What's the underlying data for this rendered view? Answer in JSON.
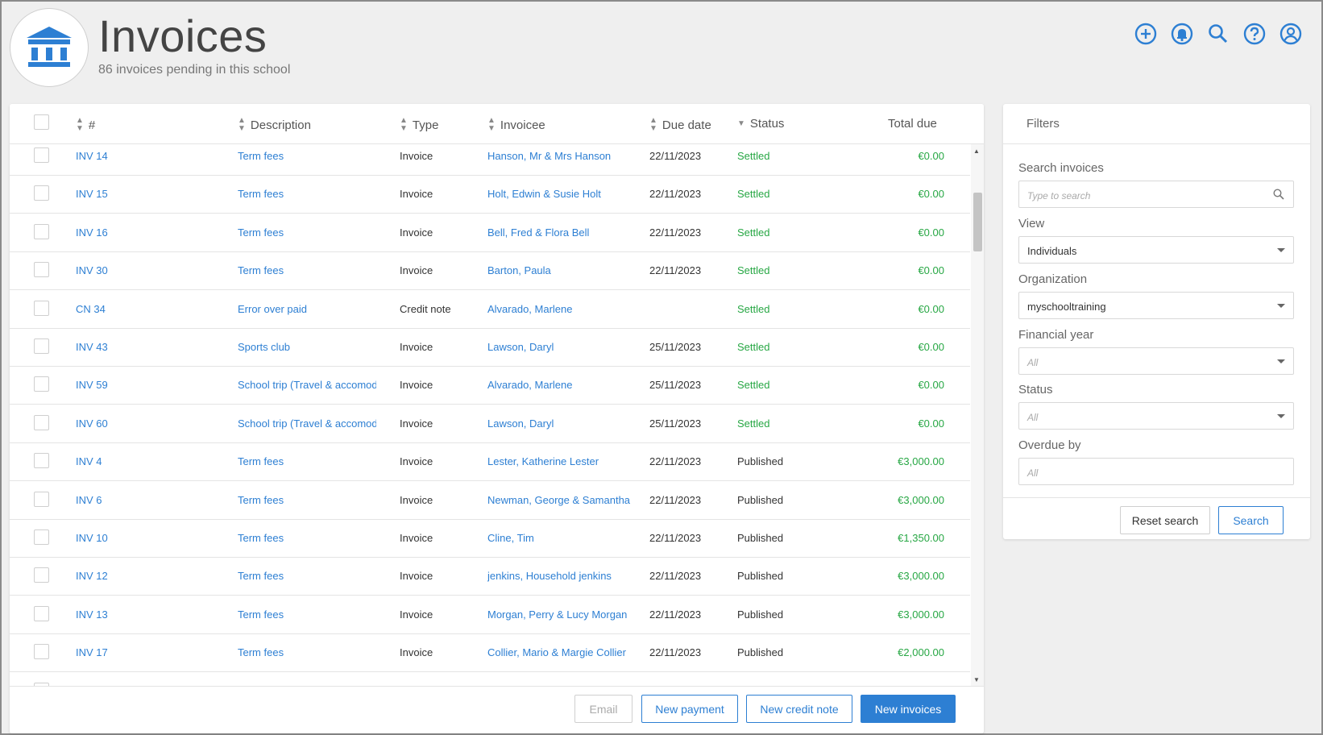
{
  "header": {
    "title": "Invoices",
    "subtitle": "86 invoices pending in this school",
    "icons": [
      "add-circle-icon",
      "bell-icon",
      "search-icon",
      "help-icon",
      "user-icon"
    ]
  },
  "colors": {
    "accent": "#2d7fd3",
    "success": "#27a744"
  },
  "table": {
    "columns": {
      "number": "#",
      "description": "Description",
      "type": "Type",
      "invoicee": "Invoicee",
      "due_date": "Due date",
      "status": "Status",
      "total_due": "Total due"
    },
    "rows": [
      {
        "number": "INV 14",
        "description": "Term fees",
        "type": "Invoice",
        "invoicee": "Hanson, Mr & Mrs Hanson",
        "due_date": "22/11/2023",
        "status": "Settled",
        "total": "€0.00"
      },
      {
        "number": "INV 15",
        "description": "Term fees",
        "type": "Invoice",
        "invoicee": "Holt, Edwin & Susie Holt",
        "due_date": "22/11/2023",
        "status": "Settled",
        "total": "€0.00"
      },
      {
        "number": "INV 16",
        "description": "Term fees",
        "type": "Invoice",
        "invoicee": "Bell, Fred & Flora Bell",
        "due_date": "22/11/2023",
        "status": "Settled",
        "total": "€0.00"
      },
      {
        "number": "INV 30",
        "description": "Term fees",
        "type": "Invoice",
        "invoicee": "Barton, Paula",
        "due_date": "22/11/2023",
        "status": "Settled",
        "total": "€0.00"
      },
      {
        "number": "CN 34",
        "description": "Error over paid",
        "type": "Credit note",
        "invoicee": "Alvarado, Marlene",
        "due_date": "",
        "status": "Settled",
        "total": "€0.00"
      },
      {
        "number": "INV 43",
        "description": "Sports club",
        "type": "Invoice",
        "invoicee": "Lawson, Daryl",
        "due_date": "25/11/2023",
        "status": "Settled",
        "total": "€0.00"
      },
      {
        "number": "INV 59",
        "description": "School trip (Travel & accomodat",
        "type": "Invoice",
        "invoicee": "Alvarado, Marlene",
        "due_date": "25/11/2023",
        "status": "Settled",
        "total": "€0.00"
      },
      {
        "number": "INV 60",
        "description": "School trip (Travel & accomodat",
        "type": "Invoice",
        "invoicee": "Lawson, Daryl",
        "due_date": "25/11/2023",
        "status": "Settled",
        "total": "€0.00"
      },
      {
        "number": "INV 4",
        "description": "Term fees",
        "type": "Invoice",
        "invoicee": "Lester, Katherine Lester",
        "due_date": "22/11/2023",
        "status": "Published",
        "total": "€3,000.00"
      },
      {
        "number": "INV 6",
        "description": "Term fees",
        "type": "Invoice",
        "invoicee": "Newman, George & Samantha",
        "due_date": "22/11/2023",
        "status": "Published",
        "total": "€3,000.00"
      },
      {
        "number": "INV 10",
        "description": "Term fees",
        "type": "Invoice",
        "invoicee": "Cline, Tim",
        "due_date": "22/11/2023",
        "status": "Published",
        "total": "€1,350.00"
      },
      {
        "number": "INV 12",
        "description": "Term fees",
        "type": "Invoice",
        "invoicee": "jenkins, Household jenkins",
        "due_date": "22/11/2023",
        "status": "Published",
        "total": "€3,000.00"
      },
      {
        "number": "INV 13",
        "description": "Term fees",
        "type": "Invoice",
        "invoicee": "Morgan, Perry & Lucy Morgan",
        "due_date": "22/11/2023",
        "status": "Published",
        "total": "€3,000.00"
      },
      {
        "number": "INV 17",
        "description": "Term fees",
        "type": "Invoice",
        "invoicee": "Collier, Mario & Margie Collier",
        "due_date": "22/11/2023",
        "status": "Published",
        "total": "€2,000.00"
      }
    ],
    "actions": {
      "email": "Email",
      "new_payment": "New payment",
      "new_credit_note": "New credit note",
      "new_invoices": "New invoices"
    }
  },
  "filters": {
    "title": "Filters",
    "search_label": "Search invoices",
    "search_placeholder": "Type to search",
    "view_label": "View",
    "view_value": "Individuals",
    "organization_label": "Organization",
    "organization_value": "myschooltraining",
    "financial_year_label": "Financial year",
    "financial_year_value": "All",
    "status_label": "Status",
    "status_value": "All",
    "overdue_label": "Overdue by",
    "overdue_value": "All",
    "reset_label": "Reset search",
    "search_button": "Search"
  }
}
